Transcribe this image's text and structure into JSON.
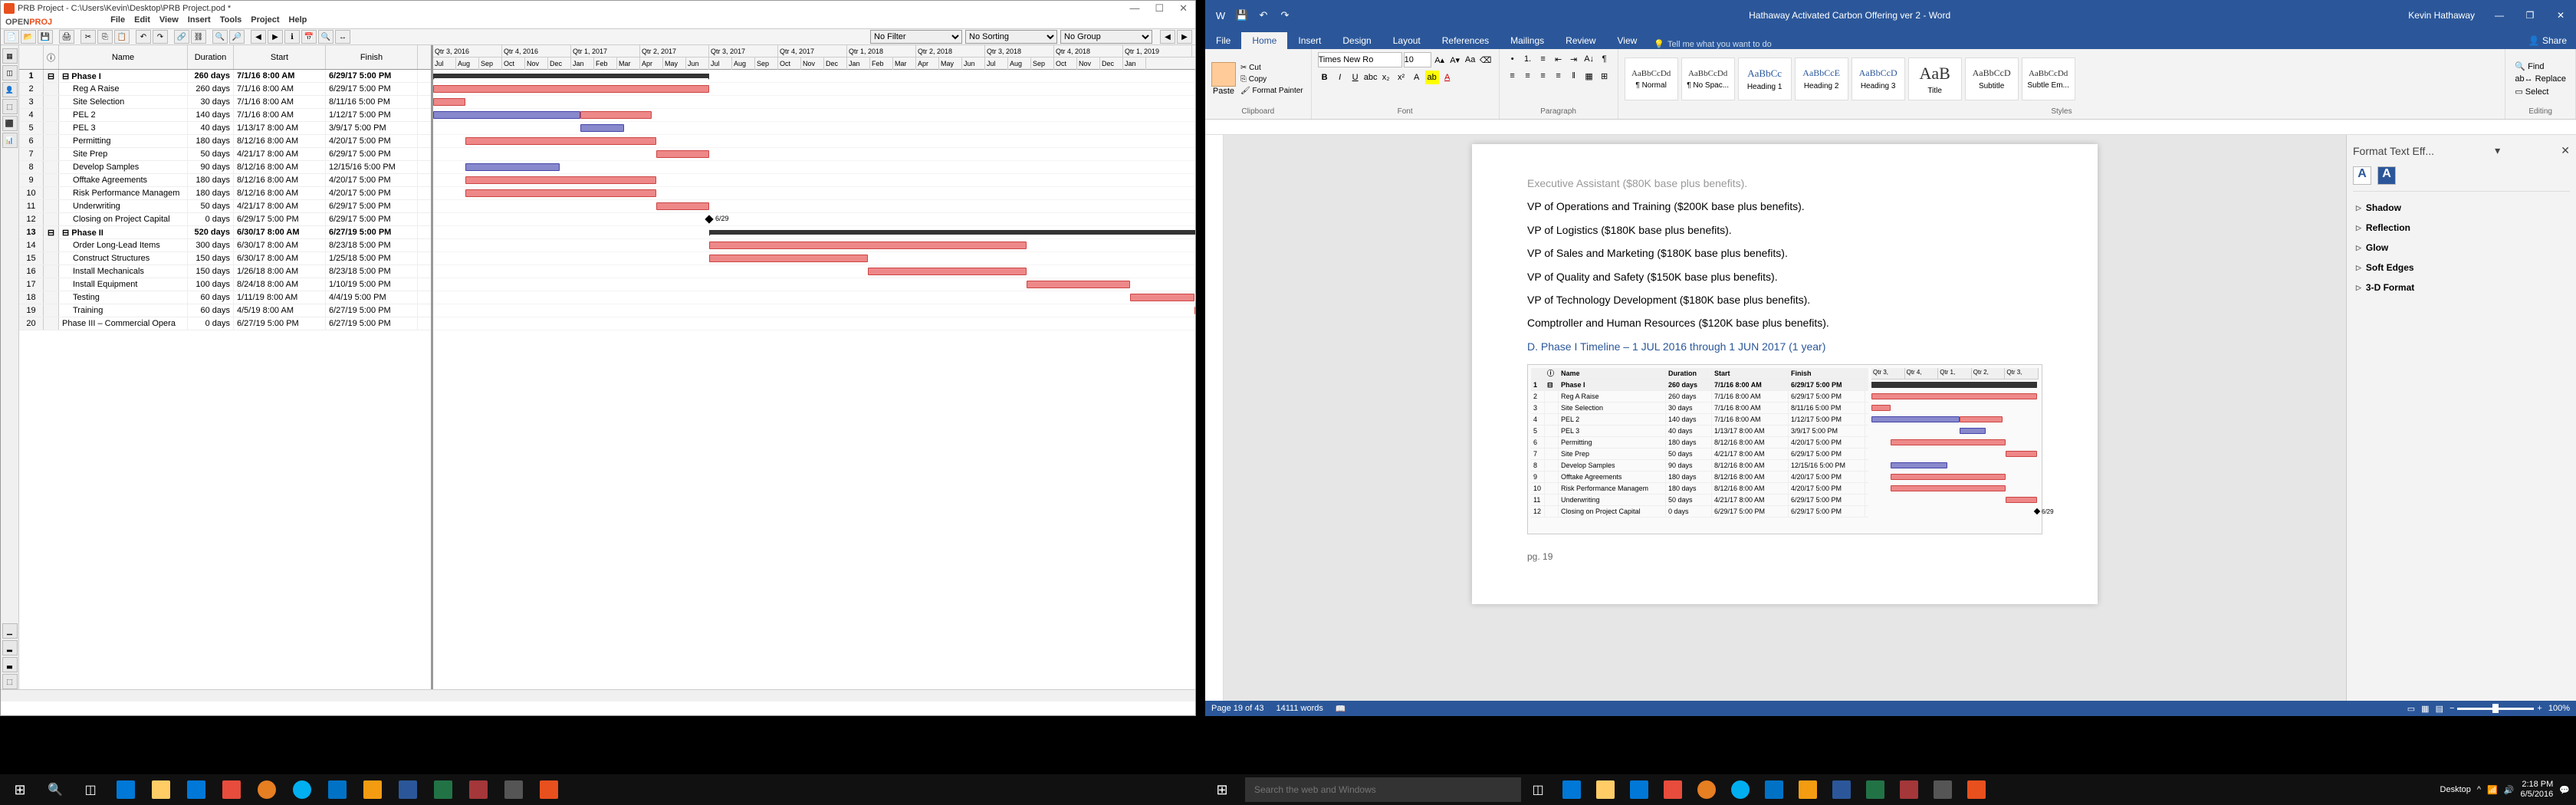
{
  "openproj": {
    "title": "PRB Project - C:\\Users\\Kevin\\Desktop\\PRB Project.pod *",
    "logo_open": "OPEN",
    "logo_proj": "PROJ",
    "menu": [
      "File",
      "Edit",
      "View",
      "Insert",
      "Tools",
      "Project",
      "Help"
    ],
    "filters": {
      "filter": "No Filter",
      "sort": "No Sorting",
      "group": "No Group"
    },
    "columns": {
      "name": "Name",
      "duration": "Duration",
      "start": "Start",
      "finish": "Finish"
    },
    "timeline_quarters": [
      "Qtr 3, 2016",
      "Qtr 4, 2016",
      "Qtr 1, 2017",
      "Qtr 2, 2017",
      "Qtr 3, 2017",
      "Qtr 4, 2017",
      "Qtr 1, 2018",
      "Qtr 2, 2018",
      "Qtr 3, 2018",
      "Qtr 4, 2018",
      "Qtr 1, 2019"
    ],
    "timeline_months": [
      "Jul",
      "Aug",
      "Sep",
      "Oct",
      "Nov",
      "Dec",
      "Jan",
      "Feb",
      "Mar",
      "Apr",
      "May",
      "Jun",
      "Jul",
      "Aug",
      "Sep",
      "Oct",
      "Nov",
      "Dec",
      "Jan",
      "Feb",
      "Mar",
      "Apr",
      "May",
      "Jun",
      "Jul",
      "Aug",
      "Sep",
      "Oct",
      "Nov",
      "Dec",
      "Jan"
    ],
    "tasks": [
      {
        "n": 1,
        "name": "Phase I",
        "dur": "260 days",
        "start": "7/1/16 8:00 AM",
        "finish": "6/29/17 5:00 PM",
        "phase": true,
        "ind": "⊟"
      },
      {
        "n": 2,
        "name": "Reg A Raise",
        "dur": "260 days",
        "start": "7/1/16 8:00 AM",
        "finish": "6/29/17 5:00 PM",
        "indent": 1
      },
      {
        "n": 3,
        "name": "Site Selection",
        "dur": "30 days",
        "start": "7/1/16 8:00 AM",
        "finish": "8/11/16 5:00 PM",
        "indent": 1
      },
      {
        "n": 4,
        "name": "PEL 2",
        "dur": "140 days",
        "start": "7/1/16 8:00 AM",
        "finish": "1/12/17 5:00 PM",
        "indent": 1
      },
      {
        "n": 5,
        "name": "PEL 3",
        "dur": "40 days",
        "start": "1/13/17 8:00 AM",
        "finish": "3/9/17 5:00 PM",
        "indent": 1
      },
      {
        "n": 6,
        "name": "Permitting",
        "dur": "180 days",
        "start": "8/12/16 8:00 AM",
        "finish": "4/20/17 5:00 PM",
        "indent": 1
      },
      {
        "n": 7,
        "name": "Site Prep",
        "dur": "50 days",
        "start": "4/21/17 8:00 AM",
        "finish": "6/29/17 5:00 PM",
        "indent": 1
      },
      {
        "n": 8,
        "name": "Develop Samples",
        "dur": "90 days",
        "start": "8/12/16 8:00 AM",
        "finish": "12/15/16 5:00 PM",
        "indent": 1
      },
      {
        "n": 9,
        "name": "Offtake Agreements",
        "dur": "180 days",
        "start": "8/12/16 8:00 AM",
        "finish": "4/20/17 5:00 PM",
        "indent": 1
      },
      {
        "n": 10,
        "name": "Risk Performance Managem",
        "dur": "180 days",
        "start": "8/12/16 8:00 AM",
        "finish": "4/20/17 5:00 PM",
        "indent": 1
      },
      {
        "n": 11,
        "name": "Underwriting",
        "dur": "50 days",
        "start": "4/21/17 8:00 AM",
        "finish": "6/29/17 5:00 PM",
        "indent": 1
      },
      {
        "n": 12,
        "name": "Closing on Project Capital",
        "dur": "0 days",
        "start": "6/29/17 5:00 PM",
        "finish": "6/29/17 5:00 PM",
        "indent": 1
      },
      {
        "n": 13,
        "name": "Phase II",
        "dur": "520 days",
        "start": "6/30/17 8:00 AM",
        "finish": "6/27/19 5:00 PM",
        "phase": true,
        "ind": "⊟"
      },
      {
        "n": 14,
        "name": "Order Long-Lead Items",
        "dur": "300 days",
        "start": "6/30/17 8:00 AM",
        "finish": "8/23/18 5:00 PM",
        "indent": 1
      },
      {
        "n": 15,
        "name": "Construct Structures",
        "dur": "150 days",
        "start": "6/30/17 8:00 AM",
        "finish": "1/25/18 5:00 PM",
        "indent": 1
      },
      {
        "n": 16,
        "name": "Install Mechanicals",
        "dur": "150 days",
        "start": "1/26/18 8:00 AM",
        "finish": "8/23/18 5:00 PM",
        "indent": 1
      },
      {
        "n": 17,
        "name": "Install Equipment",
        "dur": "100 days",
        "start": "8/24/18 8:00 AM",
        "finish": "1/10/19 5:00 PM",
        "indent": 1
      },
      {
        "n": 18,
        "name": "Testing",
        "dur": "60 days",
        "start": "1/11/19 8:00 AM",
        "finish": "4/4/19 5:00 PM",
        "indent": 1
      },
      {
        "n": 19,
        "name": "Training",
        "dur": "60 days",
        "start": "4/5/19 8:00 AM",
        "finish": "6/27/19 5:00 PM",
        "indent": 1
      },
      {
        "n": 20,
        "name": "Phase III – Commercial Opera",
        "dur": "0 days",
        "start": "6/27/19 5:00 PM",
        "finish": "6/27/19 5:00 PM"
      }
    ],
    "milestone_label": "6/29"
  },
  "word": {
    "title": "Hathaway Activated Carbon Offering ver 2 - Word",
    "user": "Kevin Hathaway",
    "tabs": [
      "File",
      "Home",
      "Insert",
      "Design",
      "Layout",
      "References",
      "Mailings",
      "Review",
      "View"
    ],
    "tell_me": "Tell me what you want to do",
    "share": "Share",
    "clipboard": {
      "label": "Clipboard",
      "paste": "Paste",
      "cut": "Cut",
      "copy": "Copy",
      "painter": "Format Painter"
    },
    "font": {
      "label": "Font",
      "name": "Times New Ro",
      "size": "10"
    },
    "paragraph": {
      "label": "Paragraph"
    },
    "styles": {
      "label": "Styles",
      "items": [
        "¶ Normal",
        "¶ No Spac...",
        "Heading 1",
        "Heading 2",
        "Heading 3",
        "Title",
        "Subtitle",
        "Subtle Em..."
      ],
      "previews": [
        "AaBbCcDd",
        "AaBbCcDd",
        "AaBbCc",
        "AaBbCcE",
        "AaBbCcD",
        "AaB",
        "AaBbCcD",
        "AaBbCcDd"
      ]
    },
    "editing": {
      "label": "Editing",
      "find": "Find",
      "replace": "Replace",
      "select": "Select"
    },
    "doc": {
      "lines": [
        "Executive Assistant ($80K base plus benefits).",
        "VP of Operations and Training ($200K base plus benefits).",
        "VP of Logistics ($180K base plus benefits).",
        "VP of Sales and Marketing ($180K base plus benefits).",
        "VP of Quality and Safety ($150K base plus benefits).",
        "VP of Technology Development ($180K base plus benefits).",
        "Comptroller and Human Resources ($120K base plus benefits)."
      ],
      "phase_heading": "D. Phase I Timeline – 1 JUL 2016 through 1 JUN 2017 (1 year)",
      "page_num": "pg. 19"
    },
    "pane": {
      "title": "Format Text Eff...",
      "items": [
        "Shadow",
        "Reflection",
        "Glow",
        "Soft Edges",
        "3-D Format"
      ]
    },
    "status": {
      "page": "Page 19 of 43",
      "words": "14111 words",
      "zoom": "100%"
    }
  },
  "taskbar": {
    "search_placeholder": "Search the web and Windows",
    "desktop": "Desktop",
    "time": "2:18 PM",
    "date": "6/5/2016"
  }
}
